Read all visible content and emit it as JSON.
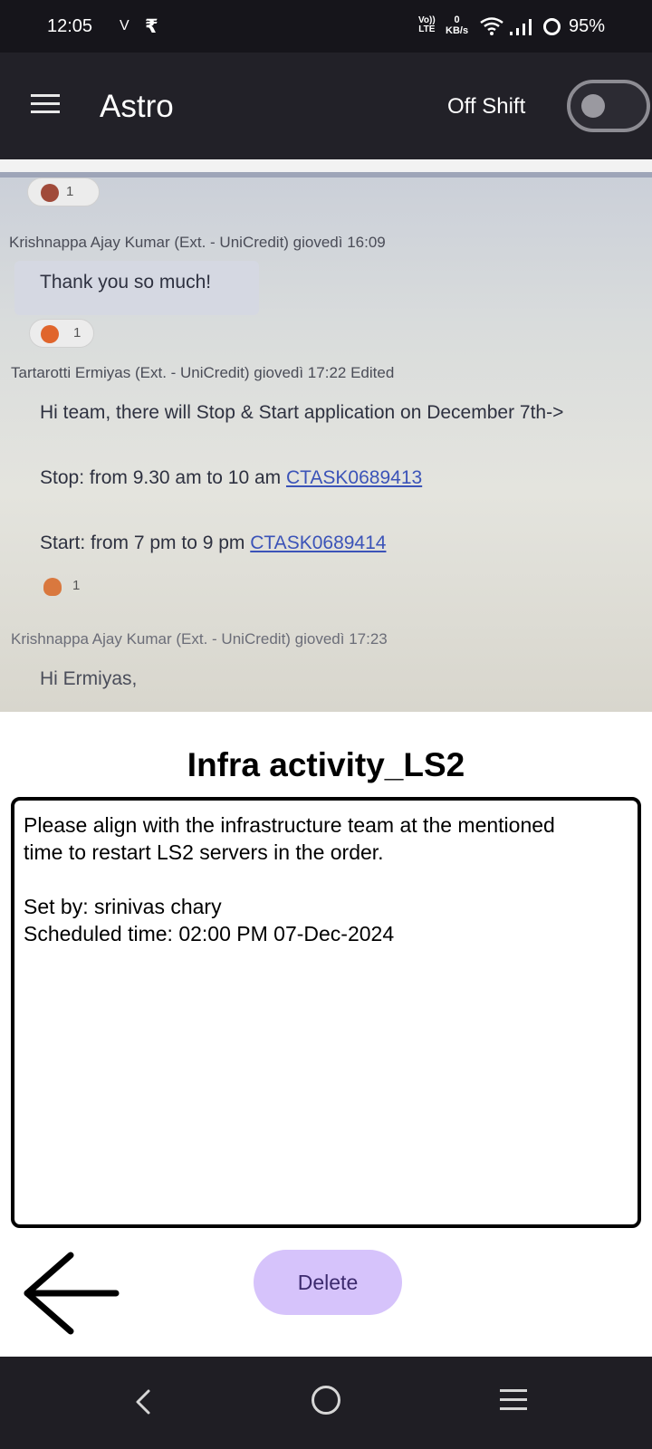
{
  "status_bar": {
    "time": "12:05",
    "carrier_indicator": "V",
    "rupee_icon": "₹",
    "lte_label": "Vo)) LTE",
    "lte_top": "Vo))",
    "lte_bottom": "LTE",
    "speed_value": "0",
    "speed_unit": "KB/s",
    "wifi_icon": "wifi-icon",
    "signal_icon": "signal-icon",
    "ring_icon": "battery-ring-icon",
    "battery": "95%"
  },
  "app_bar": {
    "title": "Astro",
    "menu_icon": "hamburger-menu-icon",
    "shift_label": "Off Shift",
    "shift_toggle_on": false
  },
  "photo": {
    "top_reaction_count": "1",
    "messages": [
      {
        "author": "Krishnappa Ajay Kumar (Ext. - UniCredit)  giovedì 16:09",
        "body": "Thank you so much!",
        "reaction_count": "1"
      },
      {
        "author": "Tartarotti Ermiyas (Ext. - UniCredit)  giovedì 17:22  Edited",
        "body_line1": "Hi team, there will Stop & Start application on December 7th->",
        "body_stop_text": "Stop: from 9.30 am to 10 am ",
        "body_stop_link": "CTASK0689413",
        "body_start_text": "Start: from 7 pm to 9 pm ",
        "body_start_link": "CTASK0689414",
        "reaction_count": "1"
      },
      {
        "author": "Krishnappa Ajay Kumar (Ext. - UniCredit)  giovedì 17:23",
        "body": "Hi Ermiyas,"
      }
    ]
  },
  "note": {
    "title": "Infra activity_LS2",
    "line1": "Please align with the infrastructure team at the mentioned",
    "line2": "time to restart LS2 servers in the order.",
    "set_by": "Set by: srinivas chary",
    "scheduled": "Scheduled time: 02:00 PM 07-Dec-2024"
  },
  "actions": {
    "back_icon": "arrow-left-icon",
    "delete_label": "Delete"
  },
  "colors": {
    "status_bar_bg": "#16151b",
    "app_bar_bg": "#222128",
    "delete_bg": "#d6c3fb",
    "delete_text": "#3c2a6e",
    "link": "#3b53b8"
  }
}
